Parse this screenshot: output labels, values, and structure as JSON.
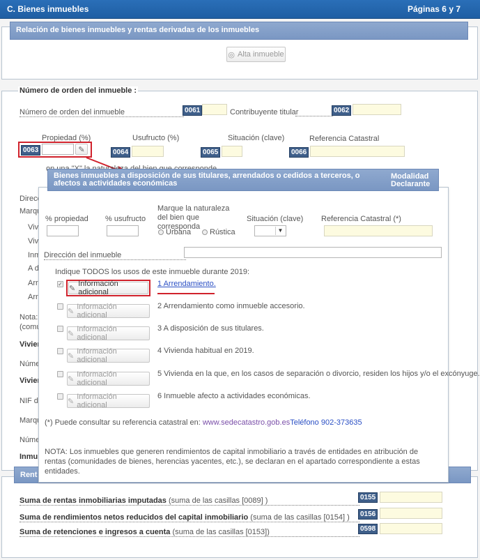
{
  "header": {
    "title": "C.  Bienes inmuebles",
    "pages": "Páginas 6 y 7"
  },
  "relacion": {
    "title": "Relación de bienes inmuebles y rentas derivadas de los inmuebles",
    "alta_button": "Alta inmueble"
  },
  "orden": {
    "legend": "Número de orden del inmueble :",
    "numero_label": "Número de orden del inmueble",
    "numero_code": "0061",
    "contribuyente_label": "Contribuyente titular",
    "contribuyente_code": "0062",
    "propiedad_label": "Propiedad (%)",
    "propiedad_code": "0063",
    "usufructo_label": "Usufructo (%)",
    "usufructo_code": "0064",
    "situacion_label": "Situación (clave)",
    "situacion_code": "0065",
    "referencia_label": "Referencia Catastral",
    "referencia_code": "0066"
  },
  "background_fragments": {
    "naturaleza_text": "on una \"X\" la naturaleza del bien que corresponde",
    "left_items": [
      "Direcc",
      "Marque",
      "Vivi",
      "Vivi",
      "Inm",
      "A di",
      "Arre",
      "Arre",
      "Nota:",
      "(comu",
      "Vivien",
      "Núme",
      "Vivien",
      "NIF de",
      "Marqu",
      "Núme",
      "Inmu",
      "Rent"
    ]
  },
  "modal": {
    "title": "Bienes inmuebles a disposición de sus titulares, arrendados o cedidos a terceros, o afectos a actividades económicas",
    "modalidad": "Modalidad Declarante",
    "propiedad_label": "% propiedad",
    "usufructo_label": "% usufructo",
    "naturaleza_label": "Marque la naturaleza del bien que corresponda",
    "urbana": "Urbana",
    "rustica": "Rústica",
    "situacion_label": "Situación (clave)",
    "referencia_label": "Referencia Catastral (*)",
    "direccion_label": "Dirección del inmueble",
    "usos_label": "Indique TODOS los usos de este inmueble durante 2019:",
    "info_button": "Información adicional",
    "usos": [
      {
        "text": "1 Arrendamiento.",
        "checked": true
      },
      {
        "text": "2 Arrendamiento como inmueble accesorio.",
        "checked": false
      },
      {
        "text": "3 A disposición de sus titulares.",
        "checked": false
      },
      {
        "text": "4 Vivienda habitual en 2019.",
        "checked": false
      },
      {
        "text": "5 Vivienda en la que, en los casos de separación o divorcio, residen los hijos y/o el excónyuge.",
        "checked": false
      },
      {
        "text": "6 Inmueble afecto a actividades económicas.",
        "checked": false
      }
    ],
    "catastro_prefix": "(*) Puede consultar su referencia catastral en:",
    "catastro_link": "www.sedecatastro.gob.es",
    "telefono": "Teléfono 902-373635",
    "nota": "NOTA: Los inmuebles que generen rendimientos de capital inmobiliario a través de entidades en atribución de rentas (comunidades de bienes, herencias yacentes, etc.), se declaran en el apartado correspondiente a estas entidades."
  },
  "sumas": [
    {
      "bold": "Suma de rentas inmobiliarias imputadas",
      "normal": " (suma de las casillas [0089] )",
      "code": "0155"
    },
    {
      "bold": "Suma de rendimientos netos reducidos del capital inmobiliario",
      "normal": " (suma de las casillas [0154] )",
      "code": "0156"
    },
    {
      "bold": "Suma de retenciones e ingresos a cuenta",
      "normal": " (suma de las casillas [0153])",
      "code": "0598"
    }
  ],
  "colors": {
    "header": "#1f5ea3",
    "accent_red": "#d0222c",
    "title_blue": "#7a97c3",
    "link": "#2a4fc4",
    "field_code": "#3f5f8a"
  }
}
